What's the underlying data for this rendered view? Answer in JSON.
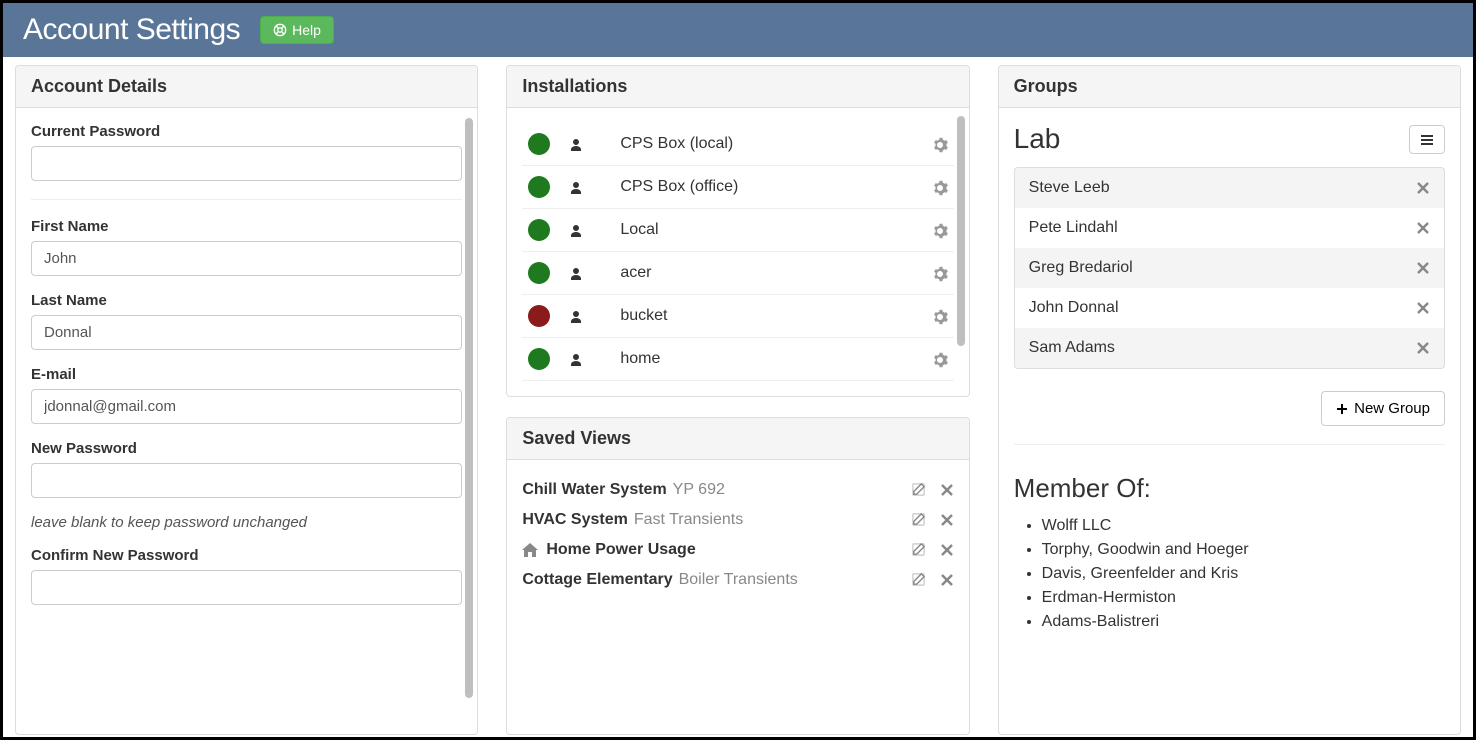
{
  "header": {
    "title": "Account Settings",
    "help_label": "Help"
  },
  "account": {
    "panel_title": "Account Details",
    "current_password_label": "Current Password",
    "current_password_value": "",
    "first_name_label": "First Name",
    "first_name_value": "John",
    "last_name_label": "Last Name",
    "last_name_value": "Donnal",
    "email_label": "E-mail",
    "email_value": "jdonnal@gmail.com",
    "new_password_label": "New Password",
    "new_password_value": "",
    "new_password_hint": "leave blank to keep password unchanged",
    "confirm_password_label": "Confirm New Password",
    "confirm_password_value": ""
  },
  "installations": {
    "panel_title": "Installations",
    "items": [
      {
        "status": "green",
        "name": "CPS Box (local)"
      },
      {
        "status": "green",
        "name": "CPS Box (office)"
      },
      {
        "status": "green",
        "name": "Local"
      },
      {
        "status": "green",
        "name": "acer"
      },
      {
        "status": "red",
        "name": "bucket"
      },
      {
        "status": "green",
        "name": "home"
      }
    ]
  },
  "saved_views": {
    "panel_title": "Saved Views",
    "items": [
      {
        "home": false,
        "name": "Chill Water System",
        "sub": "YP 692"
      },
      {
        "home": false,
        "name": "HVAC System",
        "sub": "Fast Transients"
      },
      {
        "home": true,
        "name": "Home Power Usage",
        "sub": ""
      },
      {
        "home": false,
        "name": "Cottage Elementary",
        "sub": "Boiler Transients"
      }
    ]
  },
  "groups": {
    "panel_title": "Groups",
    "group_name": "Lab",
    "members": [
      "Steve Leeb",
      "Pete Lindahl",
      "Greg Bredariol",
      "John Donnal",
      "Sam Adams"
    ],
    "new_group_label": "New Group",
    "member_of_title": "Member Of:",
    "member_of": [
      "Wolff LLC",
      "Torphy, Goodwin and Hoeger",
      "Davis, Greenfelder and Kris",
      "Erdman-Hermiston",
      "Adams-Balistreri"
    ]
  }
}
